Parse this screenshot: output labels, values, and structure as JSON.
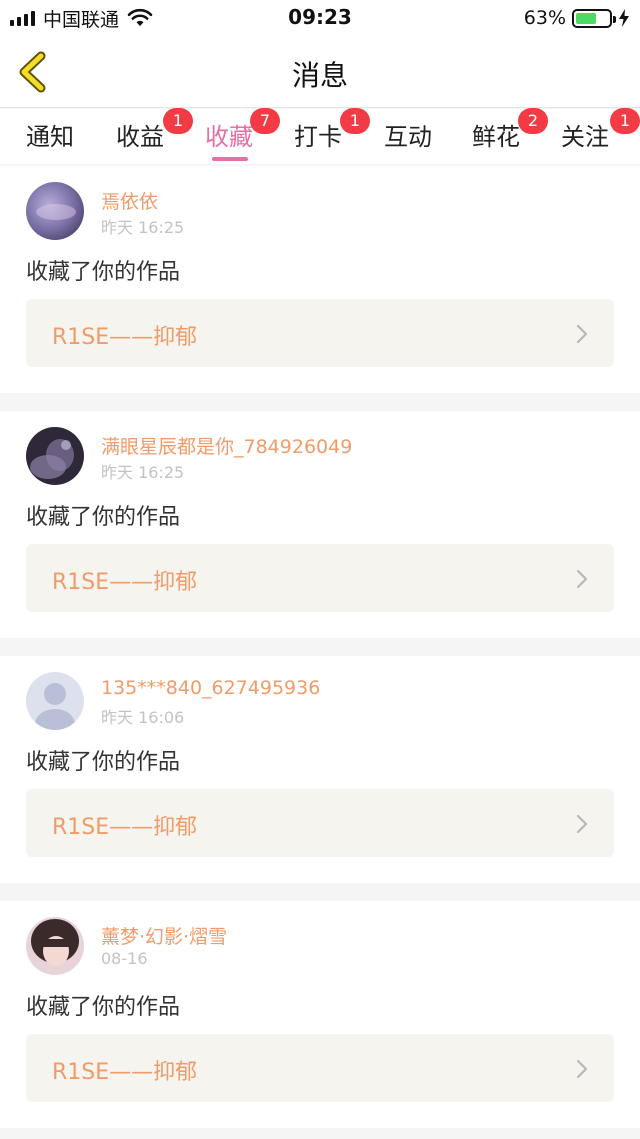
{
  "status_bar": {
    "carrier": "中国联通",
    "time": "09:23",
    "battery_percent": "63%",
    "battery_level": 0.63
  },
  "nav": {
    "title": "消息",
    "back_icon": "chevron-left-icon"
  },
  "tabs": [
    {
      "label": "通知",
      "badge": ""
    },
    {
      "label": "收益",
      "badge": "1"
    },
    {
      "label": "收藏",
      "badge": "7",
      "active": true
    },
    {
      "label": "打卡",
      "badge": "1"
    },
    {
      "label": "互动",
      "badge": ""
    },
    {
      "label": "鲜花",
      "badge": "2"
    },
    {
      "label": "关注",
      "badge": "1"
    }
  ],
  "colors": {
    "accent": "#e76fa5",
    "username": "#ef9c6a",
    "badge": "#f33b46",
    "work_bg": "#f5f4ee"
  },
  "messages": [
    {
      "username": "焉依依",
      "time": "昨天 16:25",
      "action": "收藏了你的作品",
      "work_title": "R1SE——抑郁"
    },
    {
      "username": "满眼星辰都是你_784926049",
      "time": "昨天 16:25",
      "action": "收藏了你的作品",
      "work_title": "R1SE——抑郁"
    },
    {
      "username": "135***840_627495936",
      "time": "昨天 16:06",
      "action": "收藏了你的作品",
      "work_title": "R1SE——抑郁"
    },
    {
      "username": "薰梦·幻影·熠雪",
      "time": "08-16",
      "action": "收藏了你的作品",
      "work_title": "R1SE——抑郁"
    }
  ]
}
